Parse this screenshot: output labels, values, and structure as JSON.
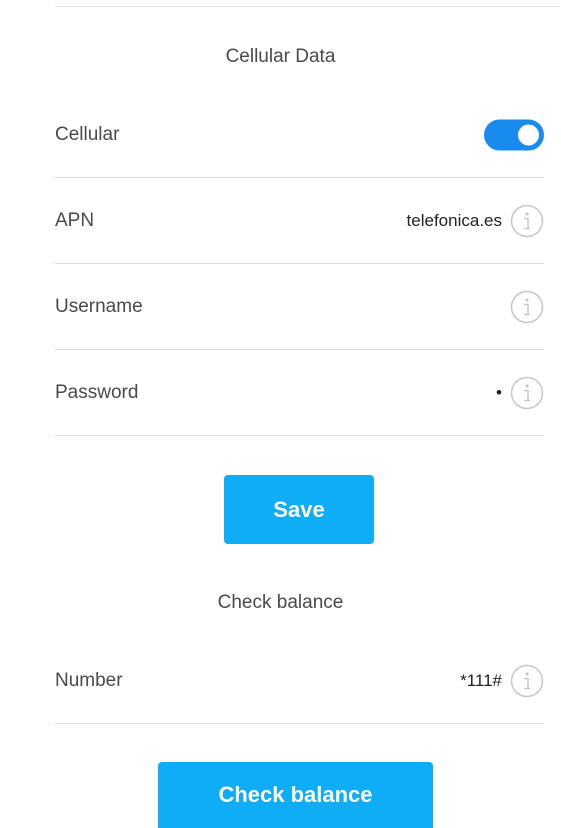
{
  "cellular_data": {
    "title": "Cellular Data",
    "rows": [
      {
        "label": "Cellular",
        "toggle_on": true
      },
      {
        "label": "APN",
        "value": "telefonica.es",
        "icon": "info-icon"
      },
      {
        "label": "Username",
        "value": "",
        "icon": "info-icon"
      },
      {
        "label": "Password",
        "masked_value": "•",
        "icon": "info-icon"
      }
    ],
    "save_label": "Save"
  },
  "check_balance": {
    "title": "Check balance",
    "rows": [
      {
        "label": "Number",
        "value": "*111#",
        "icon": "info-icon"
      }
    ],
    "button_label": "Check balance"
  },
  "colors": {
    "toggle_on": "#1a8bee",
    "button": "#0fadf5",
    "divider": "#dcdcdc",
    "icon_stroke": "#c7c7c7"
  }
}
